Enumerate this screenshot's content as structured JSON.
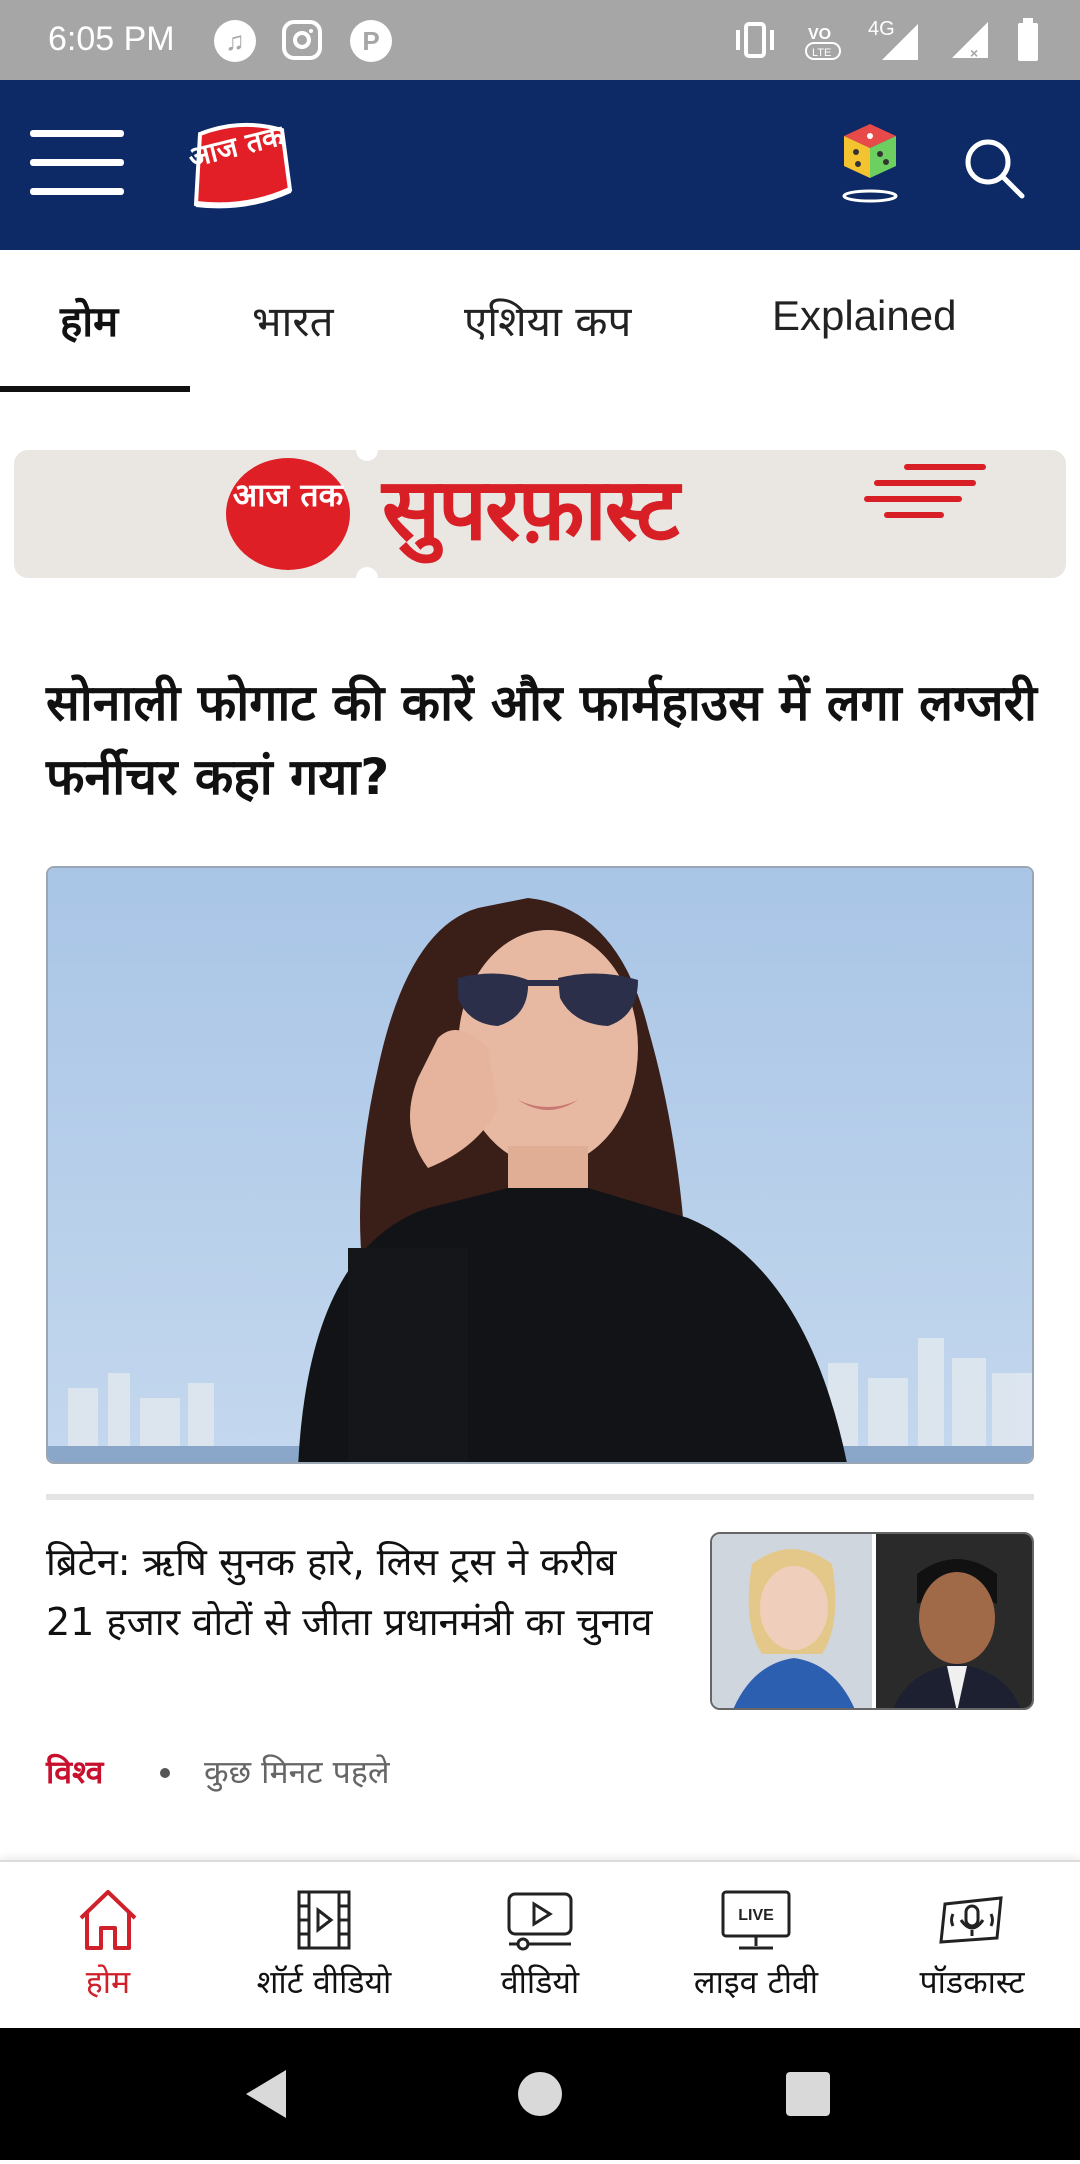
{
  "status_bar": {
    "time": "6:05 PM",
    "network_label": "4G",
    "volte_label": "VoLTE",
    "app_icons": [
      "music-app-icon",
      "instagram-icon",
      "pocket-p-icon"
    ]
  },
  "header": {
    "logo_text": "आज तक",
    "background_color": "#0d2a67"
  },
  "tabs": [
    {
      "label": "होम",
      "active": true
    },
    {
      "label": "भारत",
      "active": false
    },
    {
      "label": "एशिया कप",
      "active": false
    },
    {
      "label": "Explained",
      "active": false
    }
  ],
  "banner": {
    "logo_text": "आज तक",
    "title": "सुपरफ़ास्ट"
  },
  "lead_story": {
    "headline": "सोनाली फोगाट की कारें और फार्महाउस में लगा लग्जरी फर्नीचर कहां गया?"
  },
  "story": {
    "headline": "ब्रिटेन: ऋषि सुनक हारे, लिस ट्रस ने करीब 21 हजार वोटों से जीता प्रधानमंत्री का चुनाव",
    "category": "विश्व",
    "time": "कुछ मिनट पहले"
  },
  "bottom_nav": [
    {
      "label": "होम",
      "icon": "home-icon",
      "active": true
    },
    {
      "label": "शॉर्ट वीडियो",
      "icon": "short-video-icon",
      "active": false
    },
    {
      "label": "वीडियो",
      "icon": "video-icon",
      "active": false
    },
    {
      "label": "लाइव टीवी",
      "icon": "live-tv-icon",
      "active": false,
      "badge": "LIVE"
    },
    {
      "label": "पॉडकास्ट",
      "icon": "podcast-icon",
      "active": false
    }
  ],
  "colors": {
    "brand_red": "#d81f26",
    "header_blue": "#0d2a67",
    "active_nav": "#d0202a"
  }
}
